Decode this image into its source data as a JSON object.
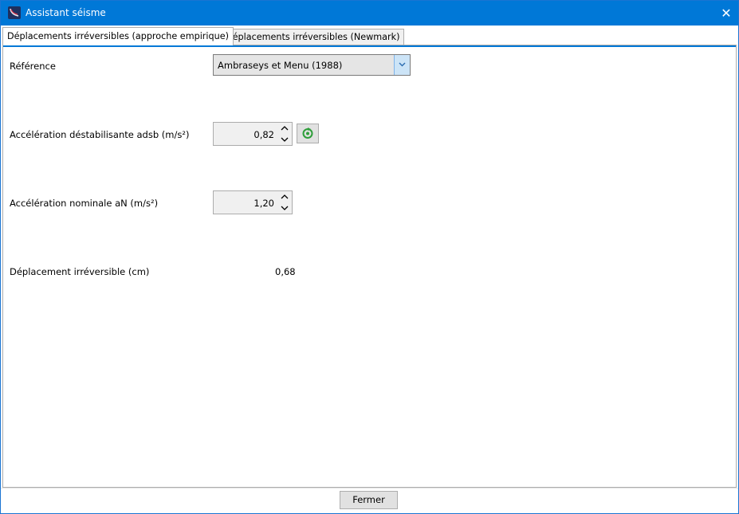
{
  "window": {
    "title": "Assistant séisme",
    "close_symbol": "✕",
    "icon": "app-seismic-icon"
  },
  "tabs": [
    {
      "label": "Déplacements irréversibles (approche empirique)",
      "active": true
    },
    {
      "label": "Déplacements irréversibles (Newmark)",
      "active": false
    }
  ],
  "form": {
    "reference_label": "Référence",
    "reference_value": "Ambraseys et Menu (1988)",
    "adsb_label": "Accélération déstabilisante adsb (m/s²)",
    "adsb_value": "0,82",
    "an_label": "Accélération nominale aN (m/s²)",
    "an_value": "1,20",
    "displacement_label": "Déplacement irréversible (cm)",
    "displacement_value": "0,68"
  },
  "footer": {
    "close_label": "Fermer"
  },
  "colors": {
    "titlebar": "#0078d7",
    "accent": "#0078d7",
    "refresh_icon": "#2e9e3a"
  }
}
